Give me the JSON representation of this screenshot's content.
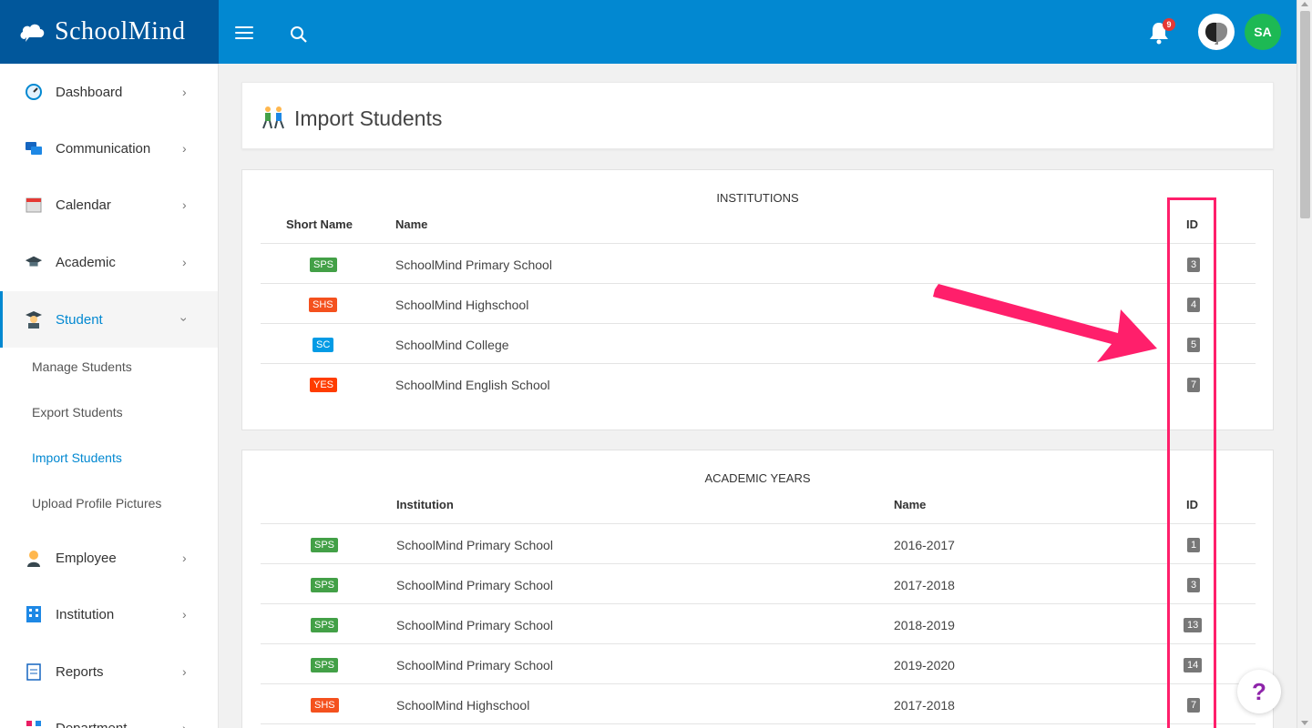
{
  "app": {
    "logo_text": "SchoolMind",
    "notification_count": "9",
    "user_initials": "SA"
  },
  "colors": {
    "primary": "#0288d1",
    "primary_dark": "#01579b",
    "tag_green": "#43a047",
    "tag_red": "#f4511e",
    "tag_blue": "#039be5",
    "tag_orange": "#ff3d00",
    "annotation": "#ff1f6b"
  },
  "sidebar": {
    "items": [
      {
        "label": "Dashboard",
        "icon": "dashboard-gauge-icon"
      },
      {
        "label": "Communication",
        "icon": "chat-icon"
      },
      {
        "label": "Calendar",
        "icon": "calendar-icon"
      },
      {
        "label": "Academic",
        "icon": "graduation-cap-icon"
      },
      {
        "label": "Student",
        "icon": "student-icon"
      },
      {
        "label": "Employee",
        "icon": "employee-icon"
      },
      {
        "label": "Institution",
        "icon": "building-icon"
      },
      {
        "label": "Reports",
        "icon": "clipboard-icon"
      },
      {
        "label": "Department",
        "icon": "department-icon"
      }
    ],
    "student_sub": [
      {
        "label": "Manage Students"
      },
      {
        "label": "Export Students"
      },
      {
        "label": "Import Students"
      },
      {
        "label": "Upload Profile Pictures"
      }
    ]
  },
  "page": {
    "title": "Import Students"
  },
  "institutions": {
    "title": "INSTITUTIONS",
    "headers": {
      "short_name": "Short Name",
      "name": "Name",
      "id": "ID"
    },
    "rows": [
      {
        "short": "SPS",
        "name": "SchoolMind Primary School",
        "id": "3"
      },
      {
        "short": "SHS",
        "name": "SchoolMind Highschool",
        "id": "4"
      },
      {
        "short": "SC",
        "name": "SchoolMind College",
        "id": "5"
      },
      {
        "short": "YES",
        "name": "SchoolMind English School",
        "id": "7"
      }
    ]
  },
  "academic_years": {
    "title": "ACADEMIC YEARS",
    "headers": {
      "institution": "Institution",
      "name": "Name",
      "id": "ID"
    },
    "rows": [
      {
        "short": "SPS",
        "institution": "SchoolMind Primary School",
        "name": "2016-2017",
        "id": "1"
      },
      {
        "short": "SPS",
        "institution": "SchoolMind Primary School",
        "name": "2017-2018",
        "id": "3"
      },
      {
        "short": "SPS",
        "institution": "SchoolMind Primary School",
        "name": "2018-2019",
        "id": "13"
      },
      {
        "short": "SPS",
        "institution": "SchoolMind Primary School",
        "name": "2019-2020",
        "id": "14"
      },
      {
        "short": "SHS",
        "institution": "SchoolMind Highschool",
        "name": "2017-2018",
        "id": "7"
      }
    ]
  },
  "help": {
    "label": "?"
  }
}
